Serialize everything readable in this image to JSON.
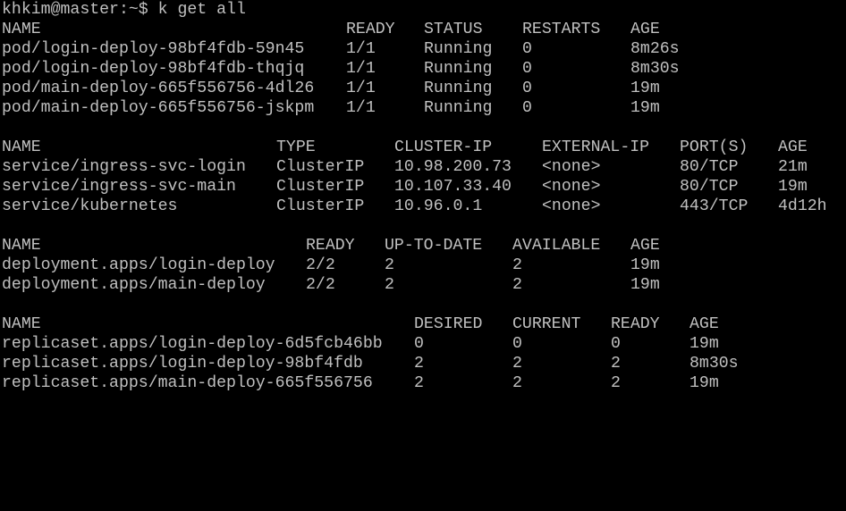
{
  "terminal": {
    "prompt": "khkim@master:~$ k get all",
    "fg_color": "#c0c0c0",
    "bg_color": "#000000"
  },
  "pods": {
    "headers": [
      "NAME",
      "READY",
      "STATUS",
      "RESTARTS",
      "AGE"
    ],
    "rows": [
      [
        "pod/login-deploy-98bf4fdb-59n45",
        "1/1",
        "Running",
        "0",
        "8m26s"
      ],
      [
        "pod/login-deploy-98bf4fdb-thqjq",
        "1/1",
        "Running",
        "0",
        "8m30s"
      ],
      [
        "pod/main-deploy-665f556756-4dl26",
        "1/1",
        "Running",
        "0",
        "19m"
      ],
      [
        "pod/main-deploy-665f556756-jskpm",
        "1/1",
        "Running",
        "0",
        "19m"
      ]
    ]
  },
  "services": {
    "headers": [
      "NAME",
      "TYPE",
      "CLUSTER-IP",
      "EXTERNAL-IP",
      "PORT(S)",
      "AGE"
    ],
    "rows": [
      [
        "service/ingress-svc-login",
        "ClusterIP",
        "10.98.200.73",
        "<none>",
        "80/TCP",
        "21m"
      ],
      [
        "service/ingress-svc-main",
        "ClusterIP",
        "10.107.33.40",
        "<none>",
        "80/TCP",
        "19m"
      ],
      [
        "service/kubernetes",
        "ClusterIP",
        "10.96.0.1",
        "<none>",
        "443/TCP",
        "4d12h"
      ]
    ]
  },
  "deployments": {
    "headers": [
      "NAME",
      "READY",
      "UP-TO-DATE",
      "AVAILABLE",
      "AGE"
    ],
    "rows": [
      [
        "deployment.apps/login-deploy",
        "2/2",
        "2",
        "2",
        "19m"
      ],
      [
        "deployment.apps/main-deploy",
        "2/2",
        "2",
        "2",
        "19m"
      ]
    ]
  },
  "replicasets": {
    "headers": [
      "NAME",
      "DESIRED",
      "CURRENT",
      "READY",
      "AGE"
    ],
    "rows": [
      [
        "replicaset.apps/login-deploy-6d5fcb46bb",
        "0",
        "0",
        "0",
        "19m"
      ],
      [
        "replicaset.apps/login-deploy-98bf4fdb",
        "2",
        "2",
        "2",
        "8m30s"
      ],
      [
        "replicaset.apps/main-deploy-665f556756",
        "2",
        "2",
        "2",
        "19m"
      ]
    ]
  }
}
